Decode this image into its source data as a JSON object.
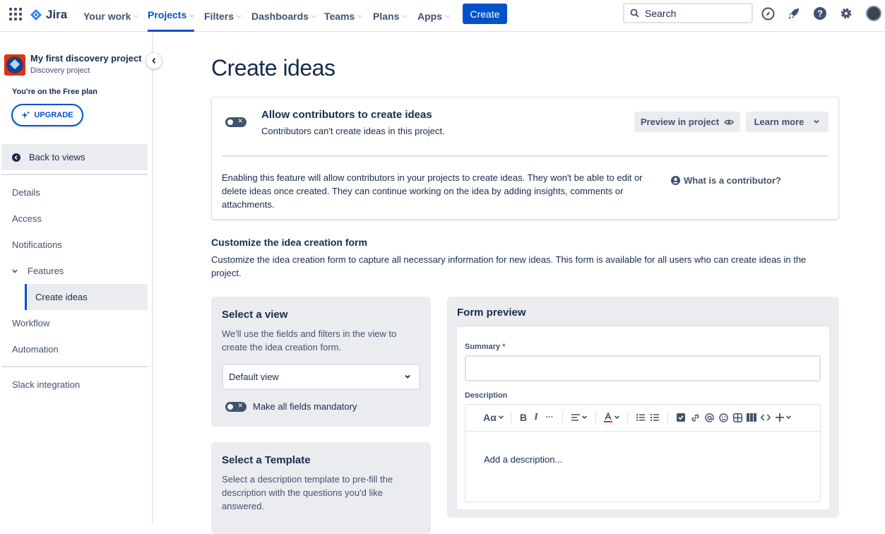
{
  "topnav": {
    "brand": "Jira",
    "items": [
      {
        "label": "Your work"
      },
      {
        "label": "Projects"
      },
      {
        "label": "Filters"
      },
      {
        "label": "Dashboards"
      },
      {
        "label": "Teams"
      },
      {
        "label": "Plans"
      },
      {
        "label": "Apps"
      }
    ],
    "active_item": "Projects",
    "create_label": "Create",
    "search_placeholder": "Search",
    "icons": [
      "app-switcher-icon",
      "compass-icon",
      "rocket-icon",
      "help-icon",
      "settings-icon",
      "avatar"
    ]
  },
  "sidebar": {
    "project_name": "My first discovery project",
    "project_type": "Discovery project",
    "plan_text": "You're on the Free plan",
    "upgrade_label": "UPGRADE",
    "back_label": "Back to views",
    "items": [
      {
        "label": "Details"
      },
      {
        "label": "Access"
      },
      {
        "label": "Notifications"
      },
      {
        "label": "Features"
      },
      {
        "label": "Create ideas"
      },
      {
        "label": "Workflow"
      },
      {
        "label": "Automation"
      },
      {
        "label": "Slack integration"
      }
    ],
    "selected_item": "Create ideas"
  },
  "main": {
    "title": "Create ideas",
    "contributors_card": {
      "toggle_on": false,
      "title": "Allow contributors to create ideas",
      "subtitle": "Contributors can't create ideas in this project.",
      "preview_label": "Preview in project",
      "learn_more_label": "Learn more",
      "description": "Enabling this feature will allow contributors in your projects to create ideas. They won't be able to edit or delete ideas once created. They can continue working on the idea by adding insights, comments or attachments.",
      "contributor_link": "What is a contributor?"
    },
    "customize": {
      "title": "Customize the idea creation form",
      "description": "Customize the idea creation form to capture all necessary information for new ideas. This form is available for all users who can create ideas in the project."
    },
    "select_view": {
      "title": "Select a view",
      "description": "We'll use the fields and filters in the view to create the idea creation form.",
      "selected": "Default view",
      "mandatory_label": "Make all fields mandatory",
      "mandatory_on": false
    },
    "select_template": {
      "title": "Select a Template",
      "description": "Select a description template to pre-fill the description with the questions you'd like answered."
    },
    "form_preview": {
      "title": "Form preview",
      "summary_label": "Summary",
      "required_mark": "*",
      "description_label": "Description",
      "description_placeholder": "Add a description...",
      "toolbar": {
        "text_style": "Aα",
        "bold": "B",
        "italic": "I",
        "more": "···"
      }
    }
  },
  "colors": {
    "brand_blue": "#0052cc",
    "panel_gray": "#ebecf0",
    "text_dark": "#172b4d",
    "text_subtle": "#42526e",
    "required_red": "#de350b"
  }
}
